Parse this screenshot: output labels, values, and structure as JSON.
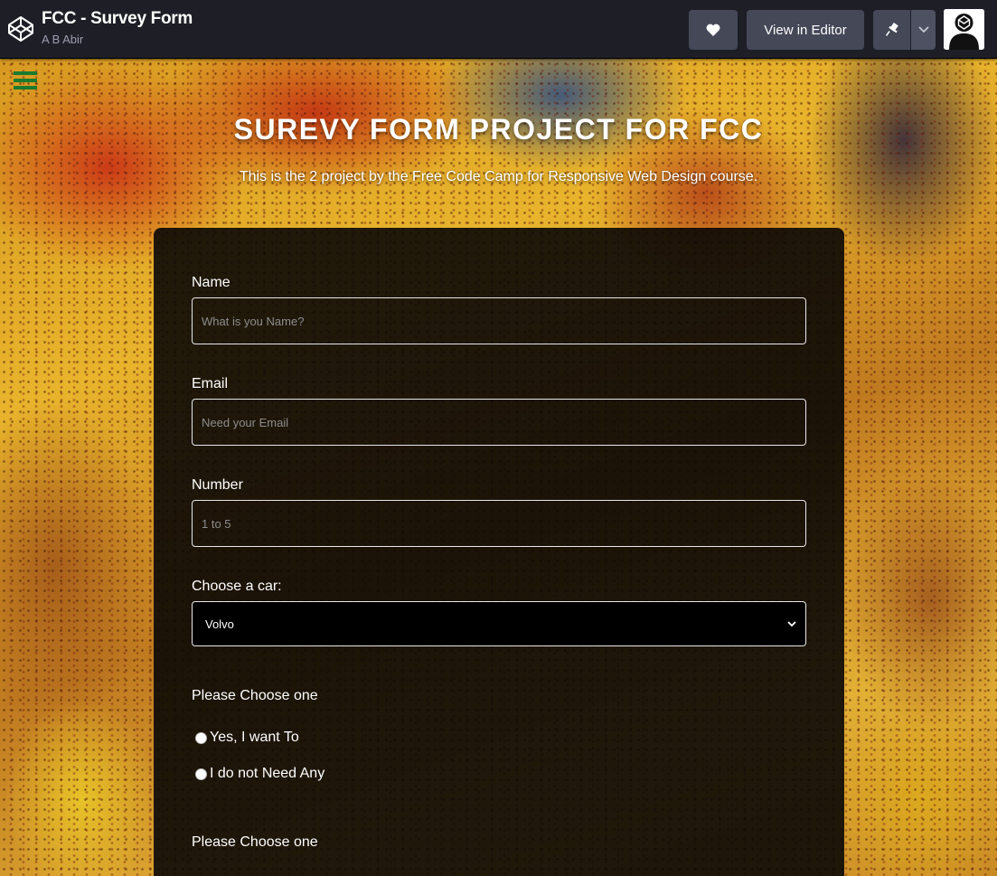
{
  "topbar": {
    "title": "FCC - Survey Form",
    "author": "A B Abir",
    "view_editor_label": "View in Editor"
  },
  "hero": {
    "title": "SUREVY FORM PROJECT FOR FCC",
    "subtitle": "This is the 2 project by the Free Code Camp for Responsive Web Design course."
  },
  "form": {
    "name": {
      "label": "Name",
      "placeholder": "What is you Name?"
    },
    "email": {
      "label": "Email",
      "placeholder": "Need your Email"
    },
    "number": {
      "label": "Number",
      "placeholder": "1 to 5"
    },
    "car": {
      "label": "Choose a car:",
      "selected": "Volvo"
    },
    "choice1": {
      "label": "Please Choose one",
      "options": [
        "Yes, I want To",
        "I do not Need Any"
      ]
    },
    "choice2": {
      "label": "Please Choose one"
    }
  },
  "colors": {
    "topbar_bg": "#1e1f26",
    "button_bg": "#444857",
    "menu_icon": "#1a7a2e"
  }
}
